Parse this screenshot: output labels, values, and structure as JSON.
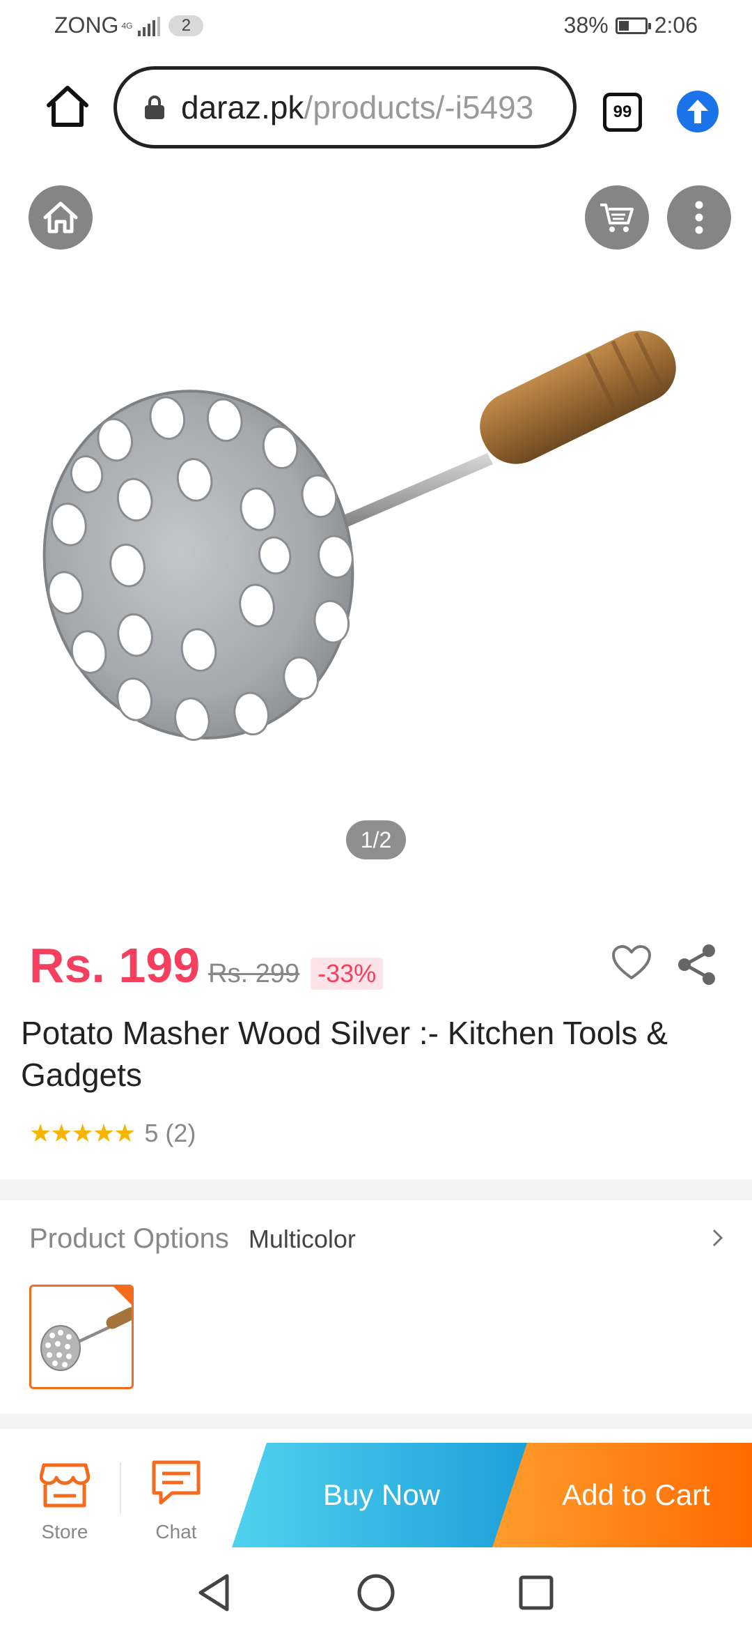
{
  "status_bar": {
    "carrier": "ZONG",
    "network": "4G",
    "sim_count": "2",
    "battery": "38%",
    "time": "2:06"
  },
  "browser": {
    "url_domain": "daraz.pk",
    "url_path": "/products/-i5493",
    "tab_count": "99"
  },
  "gallery": {
    "counter": "1/2"
  },
  "product": {
    "price": "Rs. 199",
    "original_price": "Rs. 299",
    "discount": "-33%",
    "title": "Potato Masher Wood Silver :- Kitchen Tools & Gadgets",
    "stars": "★★★★★",
    "rating": "5 (2)"
  },
  "options": {
    "label": "Product Options",
    "value": "Multicolor"
  },
  "actions": {
    "store_label": "Store",
    "chat_label": "Chat",
    "buy_now_label": "Buy Now",
    "add_to_cart_label": "Add to Cart"
  },
  "colors": {
    "price": "#f43f5e",
    "buy_now": "#1d9ed9",
    "add_to_cart": "#ff6a00",
    "accent": "#f46b1d"
  }
}
